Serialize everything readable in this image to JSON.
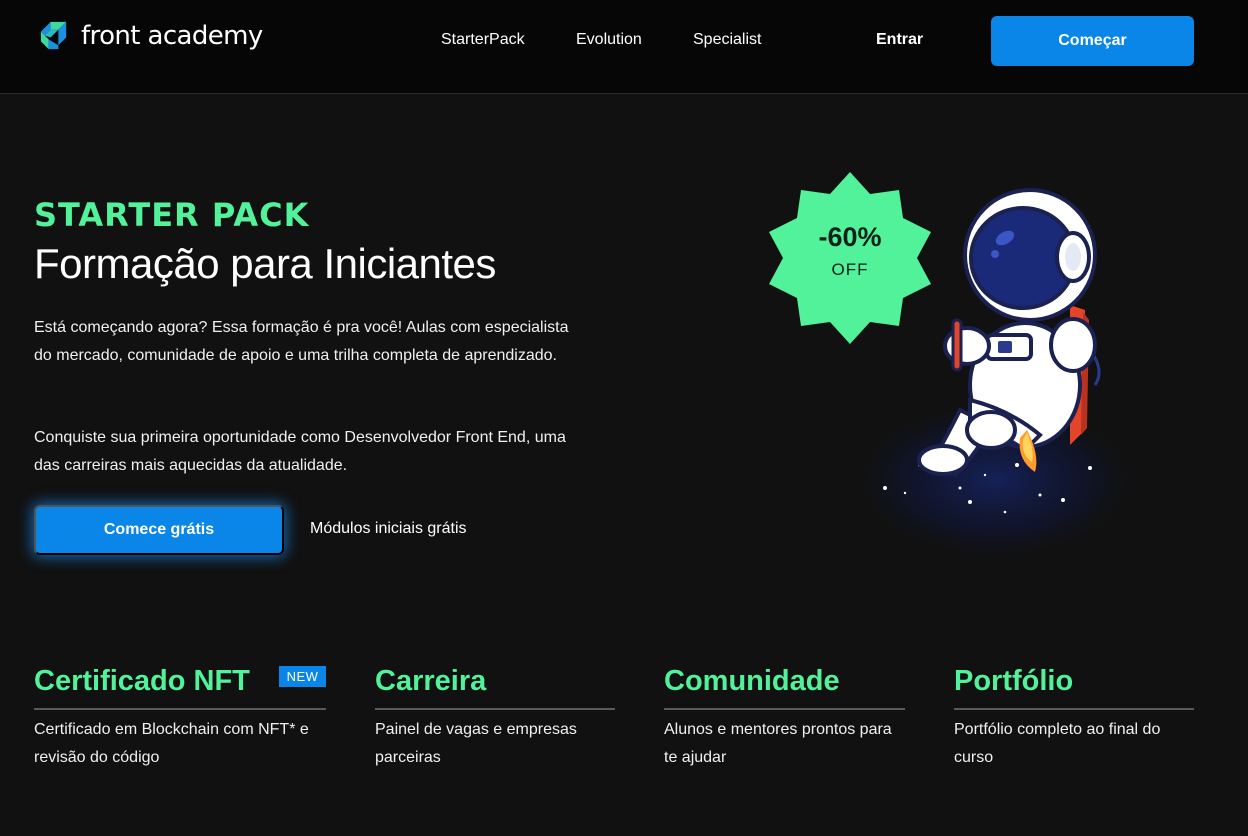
{
  "brand": {
    "name": "front academy"
  },
  "nav": {
    "items": [
      "StarterPack",
      "Evolution",
      "Specialist"
    ],
    "login": "Entrar",
    "cta": "Começar"
  },
  "hero": {
    "kicker": "STARTER PACK",
    "title": "Formação para Iniciantes",
    "paragraph1": "Está começando agora? Essa formação é pra você! Aulas com especialista do mercado, comunidade de apoio e uma trilha completa de aprendizado.",
    "paragraph2": "Conquiste sua primeira oportunidade como Desenvolvedor Front End, uma das carreiras mais aquecidas da atualidade.",
    "cta": "Comece grátis",
    "secondary": "Módulos iniciais grátis"
  },
  "badge": {
    "discount": "-60%",
    "label": "OFF"
  },
  "features": [
    {
      "title": "Certificado NFT",
      "badge": "NEW",
      "text": "Certificado em Blockchain com NFT* e revisão do código"
    },
    {
      "title": "Carreira",
      "text": "Painel de vagas e empresas parceiras"
    },
    {
      "title": "Comunidade",
      "text": "Alunos e mentores prontos para te ajudar"
    },
    {
      "title": "Portfólio",
      "text": "Portfólio completo ao final do curso"
    }
  ],
  "colors": {
    "accent_green": "#52f29a",
    "primary_blue": "#0a86e8",
    "background": "#111111",
    "header_background": "#060606"
  },
  "icons": [
    "logo-icon",
    "astronaut-illustration",
    "discount-starburst-icon"
  ]
}
